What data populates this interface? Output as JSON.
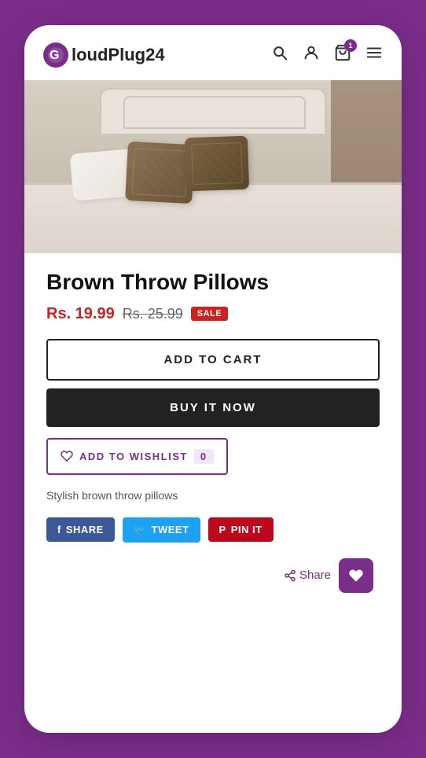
{
  "header": {
    "logo_text": "loudPlug24",
    "logo_icon": "G",
    "cart_count": "1"
  },
  "product": {
    "title": "Brown Throw Pillows",
    "price_current": "Rs. 19.99",
    "price_original": "Rs. 25.99",
    "sale_badge": "SALE",
    "description": "Stylish brown throw pillows",
    "wishlist_count": "0"
  },
  "buttons": {
    "add_to_cart": "ADD TO CART",
    "buy_it_now": "BUY IT NOW",
    "add_to_wishlist": "ADD TO WISHLIST"
  },
  "social": {
    "facebook_label": "SHARE",
    "twitter_label": "TWEET",
    "pinterest_label": "PIN IT",
    "share_label": "Share"
  },
  "icons": {
    "search": "🔍",
    "person": "👤",
    "cart": "🛒",
    "menu": "☰",
    "heart": "♡",
    "heart_filled": "♥",
    "share": "⋘"
  }
}
